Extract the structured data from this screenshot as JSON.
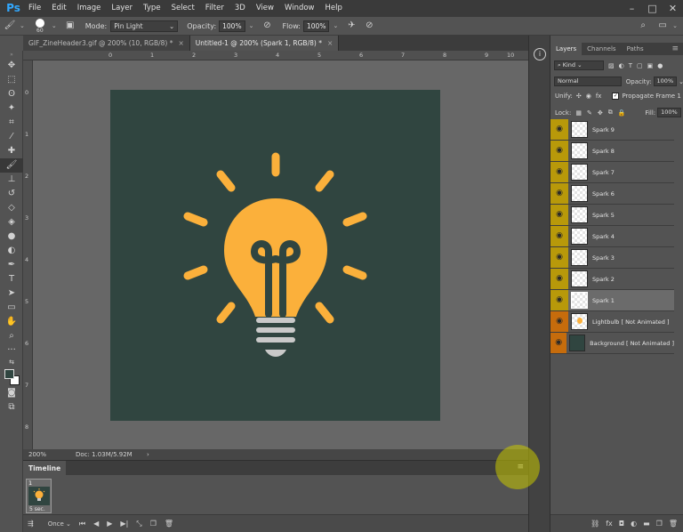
{
  "app": {
    "logo": "Ps"
  },
  "menu": [
    "File",
    "Edit",
    "Image",
    "Layer",
    "Type",
    "Select",
    "Filter",
    "3D",
    "View",
    "Window",
    "Help"
  ],
  "options_bar": {
    "brush_size": "60",
    "mode_label": "Mode:",
    "mode_value": "Pin Light",
    "opacity_label": "Opacity:",
    "opacity_value": "100%",
    "flow_label": "Flow:",
    "flow_value": "100%"
  },
  "tabs": [
    {
      "label": "GIF_ZineHeader3.gif @ 200% (10, RGB/8) *",
      "active": false
    },
    {
      "label": "Untitled-1 @ 200% (Spark 1, RGB/8) *",
      "active": true
    }
  ],
  "rulers": {
    "top": [
      "0",
      "1",
      "2",
      "3",
      "4",
      "5",
      "6",
      "7",
      "8",
      "9",
      "10"
    ],
    "left": [
      "0",
      "1",
      "2",
      "3",
      "4",
      "5",
      "6",
      "7",
      "8"
    ]
  },
  "status": {
    "zoom": "200%",
    "doc": "Doc: 1.03M/5.92M"
  },
  "timeline": {
    "tab": "Timeline",
    "frame_number": "1",
    "frame_delay": "5 sec.",
    "loop": "Once"
  },
  "panels": {
    "tabs": [
      "Layers",
      "Channels",
      "Paths"
    ],
    "filter_kind": "Kind",
    "blend_mode": "Normal",
    "opacity_label": "Opacity:",
    "opacity_value": "100%",
    "unify_label": "Unify:",
    "propagate_label": "Propagate Frame 1",
    "lock_label": "Lock:",
    "fill_label": "Fill:",
    "fill_value": "100%"
  },
  "layers": [
    {
      "name": "Spark 9"
    },
    {
      "name": "Spark 8"
    },
    {
      "name": "Spark 7"
    },
    {
      "name": "Spark 6"
    },
    {
      "name": "Spark 5"
    },
    {
      "name": "Spark 4"
    },
    {
      "name": "Spark 3"
    },
    {
      "name": "Spark 2"
    },
    {
      "name": "Spark 1"
    },
    {
      "name": "Lightbulb [ Not Animated ]"
    },
    {
      "name": "Background [ Not Animated ]"
    }
  ],
  "colors": {
    "canvas_bg": "#304540",
    "bulb": "#fbb03b",
    "base": "#c9c9c9",
    "eye_yellow": "#b8990a",
    "eye_orange": "#c66c0c"
  }
}
